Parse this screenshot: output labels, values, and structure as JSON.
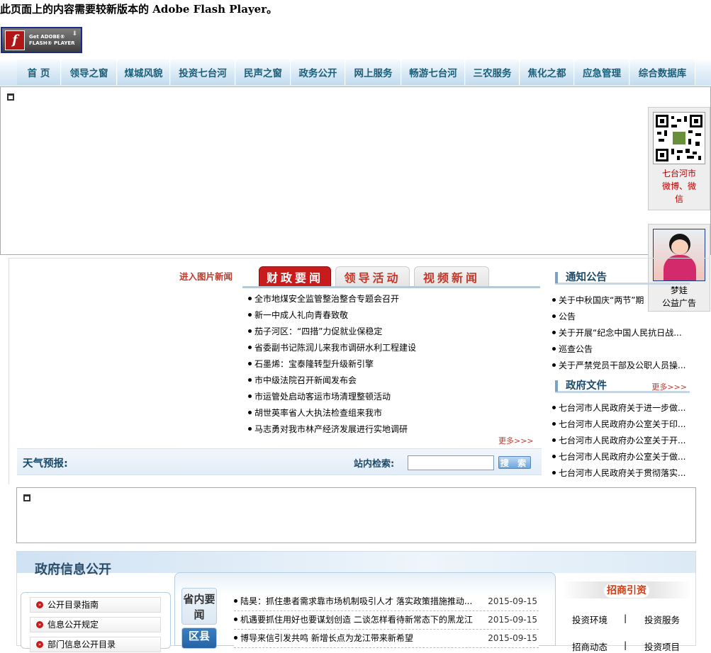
{
  "flash_notice": "此页面上的内容需要较新版本的 Adobe Flash Player。",
  "flash_button": {
    "line1": "Get ADOBE®",
    "line2": "FLASH® PLAYER",
    "icon": "flash-player-icon"
  },
  "nav": [
    "首  页",
    "领导之窗",
    "煤城风貌",
    "投资七台河",
    "民声之窗",
    "政务公开",
    "网上服务",
    "畅游七台河",
    "三农服务",
    "焦化之都",
    "应急管理",
    "综合数据库"
  ],
  "float_weibo": {
    "caption_lines": [
      "七台河市",
      "微博、微",
      "信"
    ]
  },
  "float_ad": {
    "caption_lines": [
      "梦娃",
      "公益广告"
    ]
  },
  "pic_news_link": "进入图片新闻",
  "tabs": [
    "财政要闻",
    "领导活动",
    "视频新闻"
  ],
  "news": [
    "全市地煤安全监管整治整合专题会召开",
    "新一中成人礼向青春致敬",
    "茄子河区：“四措”力促就业保稳定",
    "省委副书记陈润儿来我市调研水利工程建设",
    "石墨烯：宝泰隆转型升级新引擎",
    "市中级法院召开新闻发布会",
    "市运管处启动客运市场清理整顿活动",
    "胡世英率省人大执法检查组来我市",
    "马志勇对我市林产经济发展进行实地调研"
  ],
  "more_label": "更多>>>",
  "weather_label": "天气预报:",
  "search": {
    "label": "站内检索:",
    "button": "搜 索",
    "value": ""
  },
  "notice": {
    "title": "通知公告",
    "items": [
      "关于中秋国庆“两节”期",
      "公告",
      "关于开展“纪念中国人民抗日战...",
      "巡查公告",
      "关于严禁党员干部及公职人员操..."
    ]
  },
  "gov_docs": {
    "title": "政府文件",
    "more": "更多>>>",
    "items": [
      "七台河市人民政府关于进一步做...",
      "七台河市人民政府办公室关于印...",
      "七台河市人民政府办公室关于开...",
      "七台河市人民政府办公室关于做...",
      "七台河市人民政府关于贯彻落实..."
    ]
  },
  "info_public": {
    "title": "政府信息公开",
    "menu": [
      "公开目录指南",
      "信息公开规定",
      "部门信息公开目录"
    ]
  },
  "province_news": {
    "tab1": "省内要闻",
    "tab2": "区县",
    "items": [
      {
        "text": "陆昊：抓住患者需求靠市场机制吸引人才 落实政策措施推动...",
        "date": "2015-09-15"
      },
      {
        "text": "机遇要抓住用好也要谋划创造 二谈怎样看待新常态下的黑龙江",
        "date": "2015-09-15"
      },
      {
        "text": "博导来信引发共鸣 新增长点为龙江带来新希望",
        "date": "2015-09-15"
      }
    ]
  },
  "invest": {
    "title": "招商引资",
    "row1": [
      "投资环境",
      "|",
      "投资服务"
    ],
    "row2": [
      "招商动态",
      "|",
      "投资项目"
    ]
  }
}
